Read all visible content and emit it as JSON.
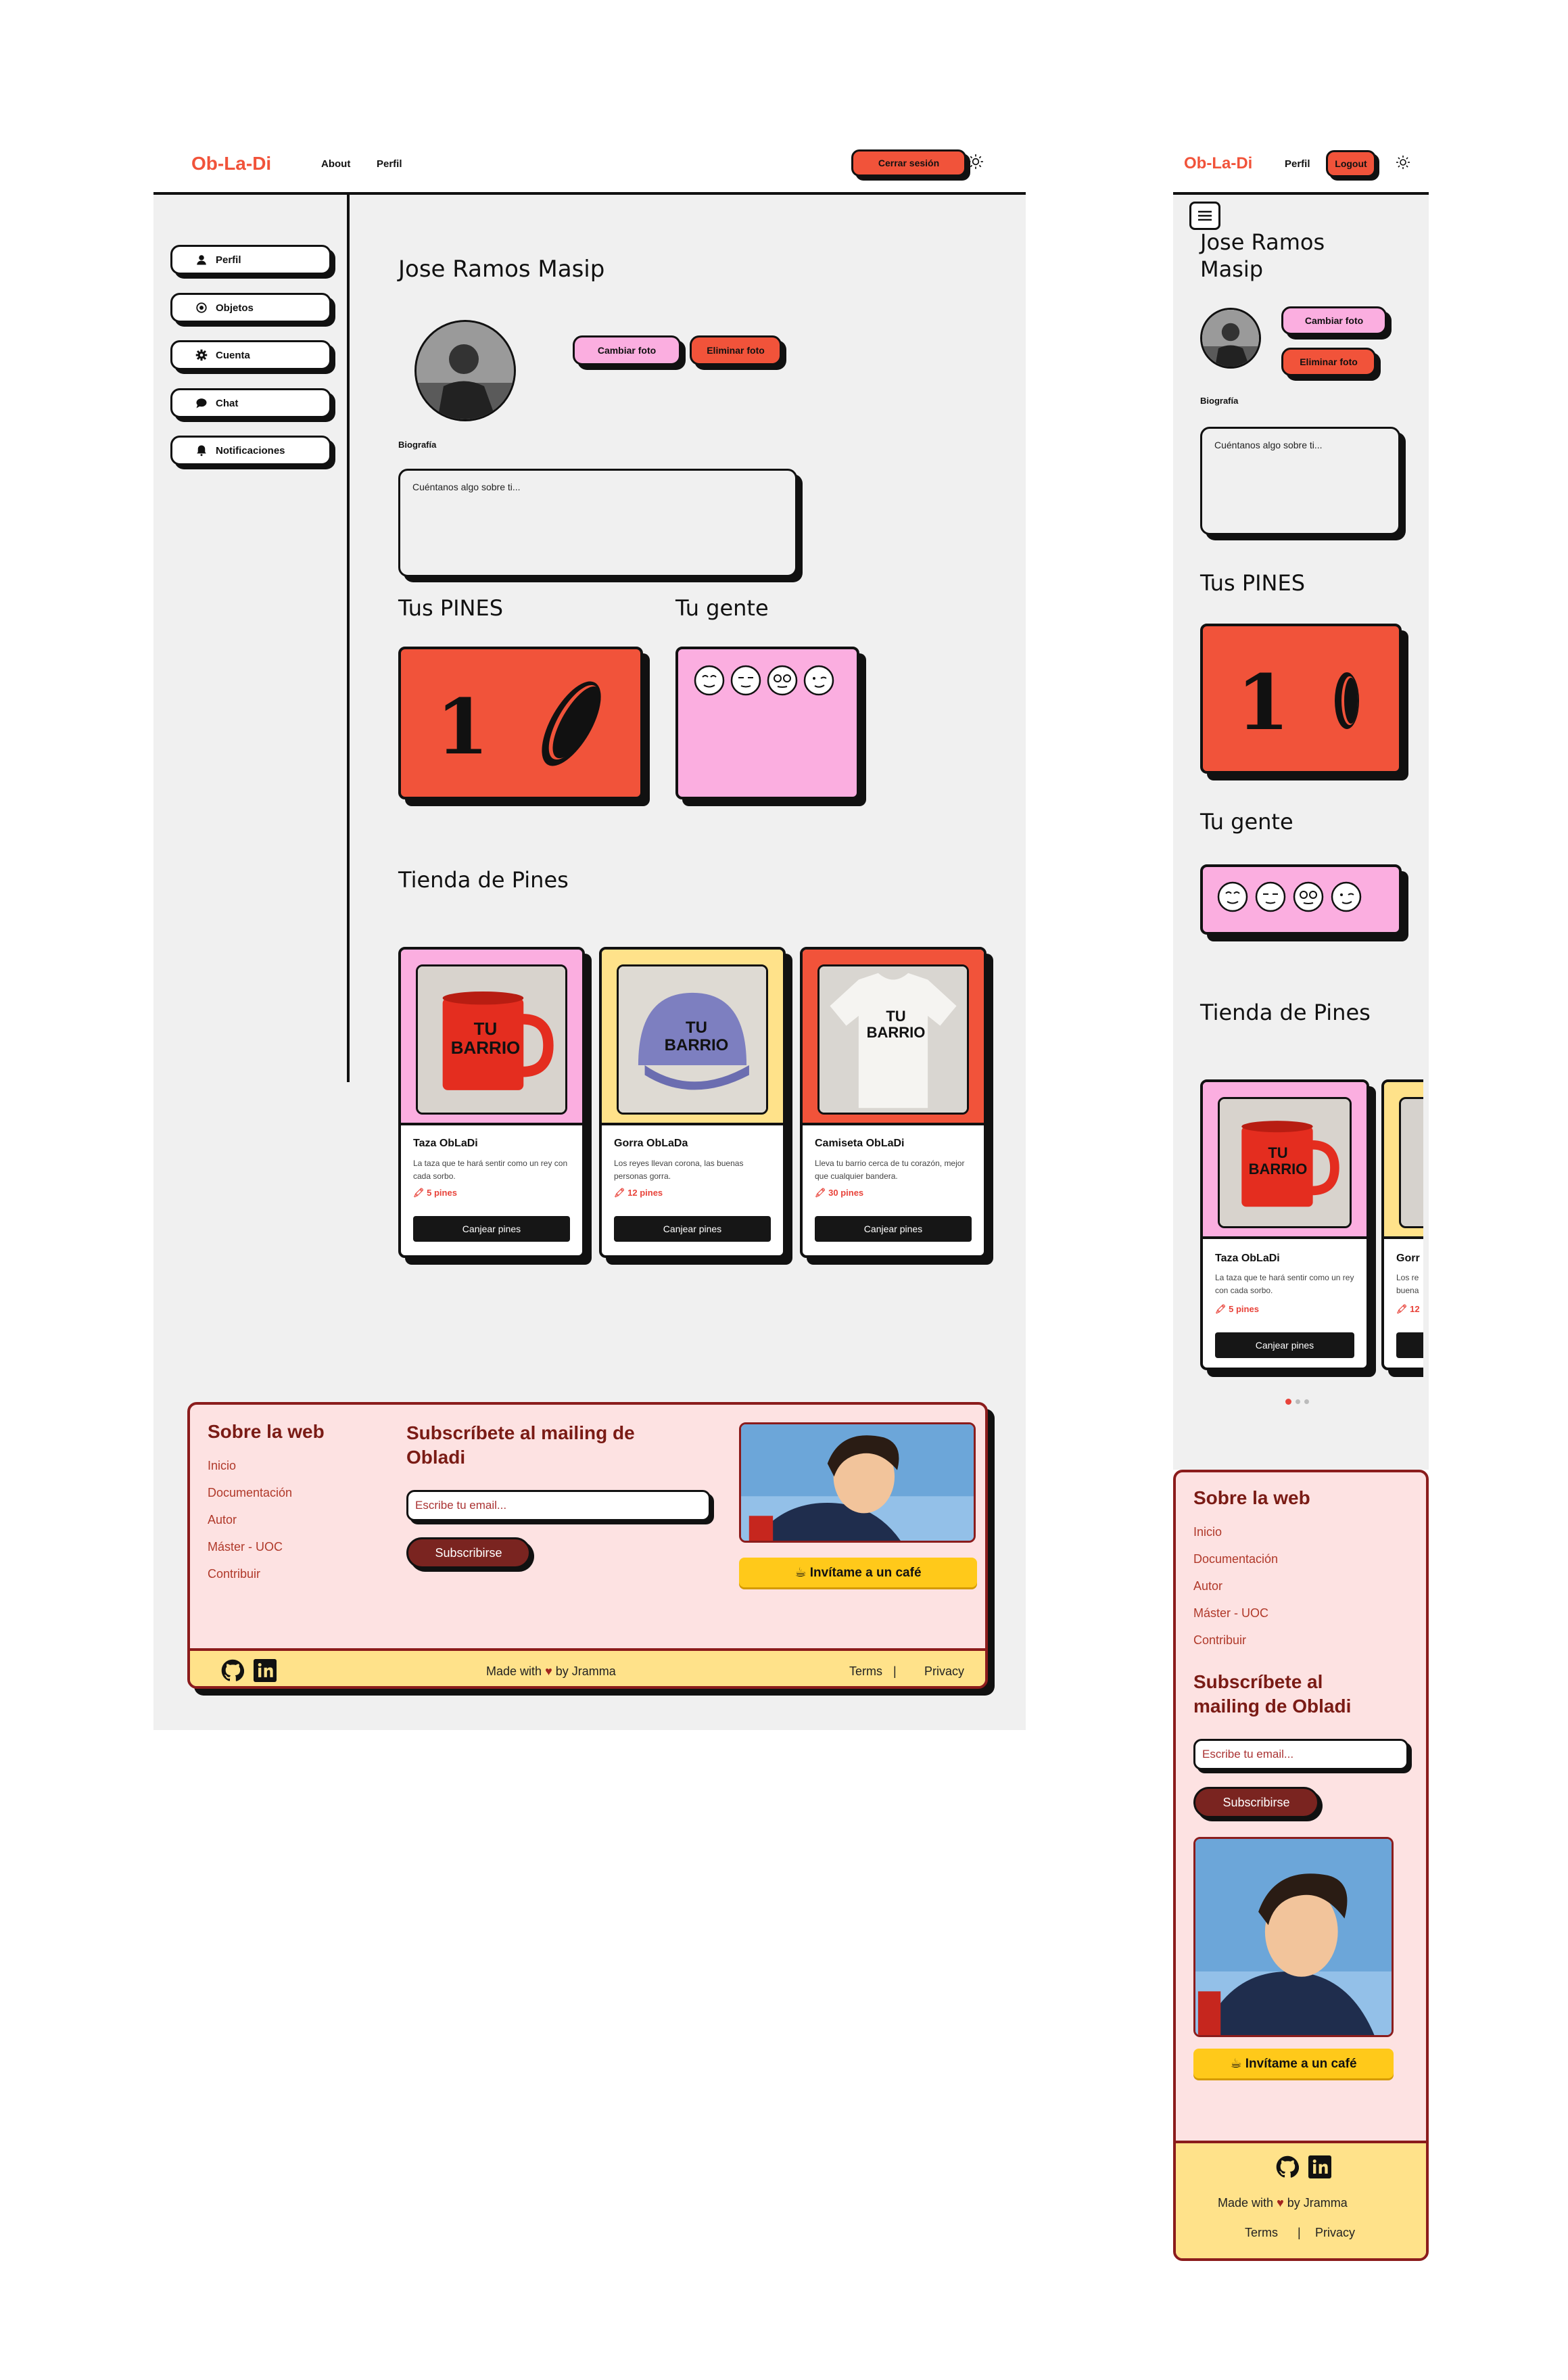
{
  "brand": "Ob-La-Di",
  "desktop": {
    "nav": {
      "about": "About",
      "perfil": "Perfil",
      "logout": "Cerrar sesión",
      "theme_icon": "sun-icon"
    },
    "sidebar": {
      "items": [
        {
          "label": "Perfil",
          "icon": "user-icon"
        },
        {
          "label": "Objetos",
          "icon": "target-icon"
        },
        {
          "label": "Cuenta",
          "icon": "gear-icon"
        },
        {
          "label": "Chat",
          "icon": "chat-icon"
        },
        {
          "label": "Notificaciones",
          "icon": "bell-icon"
        }
      ]
    },
    "profile": {
      "name": "Jose Ramos Masip",
      "change_photo": "Cambiar foto",
      "delete_photo": "Eliminar foto",
      "bio_label": "Biografía",
      "bio_placeholder": "Cuéntanos algo sobre ti..."
    },
    "pins": {
      "title": "Tus PINES",
      "count": "1"
    },
    "people": {
      "title": "Tu gente",
      "faces": 4
    },
    "store": {
      "title": "Tienda de Pines",
      "products": [
        {
          "name": "Taza ObLaDi",
          "desc": "La taza que te hará sentir como un rey con cada sorbo.",
          "price": "5 pines",
          "button": "Canjear pines",
          "image_text": "TU BARRIO",
          "bg": "#fbaee0"
        },
        {
          "name": "Gorra ObLaDa",
          "desc": "Los reyes llevan corona, las buenas personas gorra.",
          "price": "12 pines",
          "button": "Canjear pines",
          "image_text": "TU BARRIO",
          "bg": "#ffe28a"
        },
        {
          "name": "Camiseta ObLaDi",
          "desc": "Lleva tu barrio cerca de tu corazón, mejor que cualquier bandera.",
          "price": "30 pines",
          "button": "Canjear pines",
          "image_text": "TU BARRIO",
          "bg": "#f1533a"
        }
      ]
    },
    "footer": {
      "about_title": "Sobre la web",
      "links": [
        "Inicio",
        "Documentación",
        "Autor",
        "Máster - UOC",
        "Contribuir"
      ],
      "subscribe_title": "Subscríbete al mailing de Obladi",
      "email_placeholder": "Escribe tu email...",
      "subscribe_button": "Subscribirse",
      "coffee": "☕ Invítame a un café",
      "made_with": "Made with",
      "by": "by Jramma",
      "terms": "Terms",
      "sep": "|",
      "privacy": "Privacy"
    }
  },
  "mobile": {
    "nav": {
      "perfil": "Perfil",
      "logout": "Logout",
      "theme_icon": "sun-icon",
      "menu_icon": "menu-icon"
    },
    "profile": {
      "name_line1": "Jose Ramos",
      "name_line2": "Masip",
      "change_photo": "Cambiar foto",
      "delete_photo": "Eliminar foto",
      "bio_label": "Biografía",
      "bio_placeholder": "Cuéntanos algo sobre ti..."
    },
    "pins": {
      "title": "Tus PINES",
      "count": "1"
    },
    "people": {
      "title": "Tu gente"
    },
    "store": {
      "title": "Tienda de Pines",
      "product": {
        "name": "Taza ObLaDi",
        "desc": "La taza que te hará sentir como un rey con cada sorbo.",
        "price": "5 pines",
        "button": "Canjear pines",
        "image_text": "TU BARRIO"
      },
      "peek_name": "Gorr",
      "peek_desc1": "Los re",
      "peek_desc2": "buena",
      "peek_price": "12"
    },
    "footer": {
      "about_title": "Sobre la web",
      "links": [
        "Inicio",
        "Documentación",
        "Autor",
        "Máster - UOC",
        "Contribuir"
      ],
      "subscribe_title_1": "Subscríbete al",
      "subscribe_title_2": "mailing de Obladi",
      "email_placeholder": "Escribe tu email...",
      "subscribe_button": "Subscribirse",
      "coffee": "☕ Invítame a un café",
      "made_with": "Made with",
      "by": "by Jramma",
      "terms": "Terms",
      "sep": "|",
      "privacy": "Privacy"
    }
  },
  "colors": {
    "red": "#f1533a",
    "pink": "#fbaee0",
    "yellow": "#ffe28a",
    "footer_bg": "#fde2e2",
    "maroon": "#7a1b15"
  }
}
